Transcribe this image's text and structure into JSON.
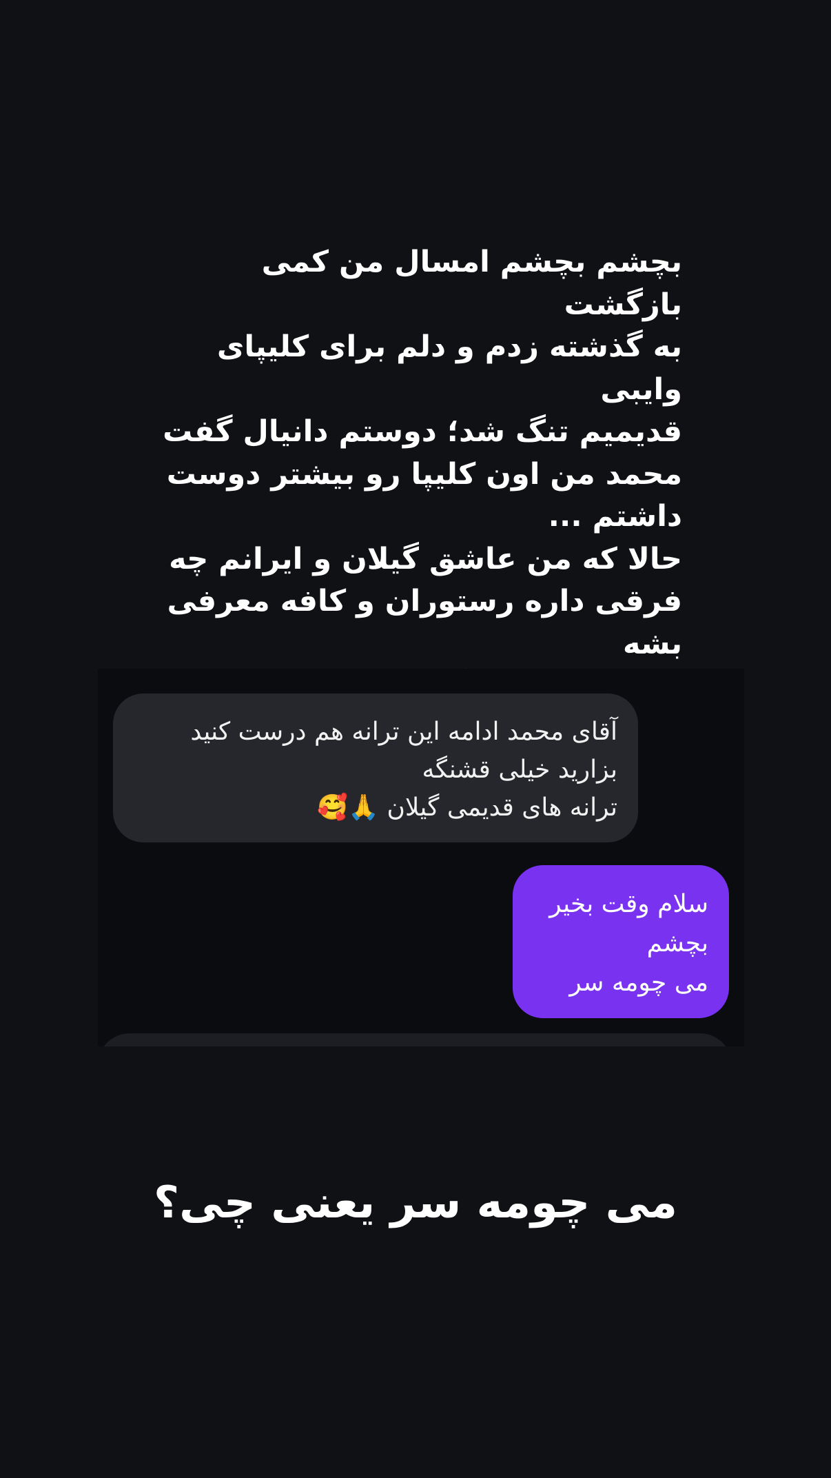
{
  "story": {
    "caption": "بچشم بچشم امسال من کمی بازگشت\nبه گذشته زدم و دلم برای کلیپای وایبی\nقدیمیم تنگ شد؛ دوستم دانیال گفت\nمحمد من اون کلیپا رو بیشتر دوست\nداشتم ...\nحالا که من عاشق گیلان و ایرانم چه\nفرقی داره رستوران و کافه معرفی بشه\nیا یه کلیپ قشنگ؛ تلاشم انتشار حسِ\nخوبه و داشتن‌تون تنها سرمایه‌م 🤍"
  },
  "chat": {
    "incoming_message": "آقای محمد ادامه این ترانه هم درست کنید\nبزارید  خیلی قشنگه\nترانه های قدیمی گیلان 🙏🥰",
    "outgoing_message": "سلام وقت بخیر\nبچشم\nمی چومه سر"
  },
  "question": "می چومه سر یعنی چی؟",
  "colors": {
    "background": "#0f1115",
    "chat_panel": "#0a0c10",
    "incoming_bubble": "#25272c",
    "outgoing_bubble": "#7a32f1",
    "text": "#ffffff"
  }
}
